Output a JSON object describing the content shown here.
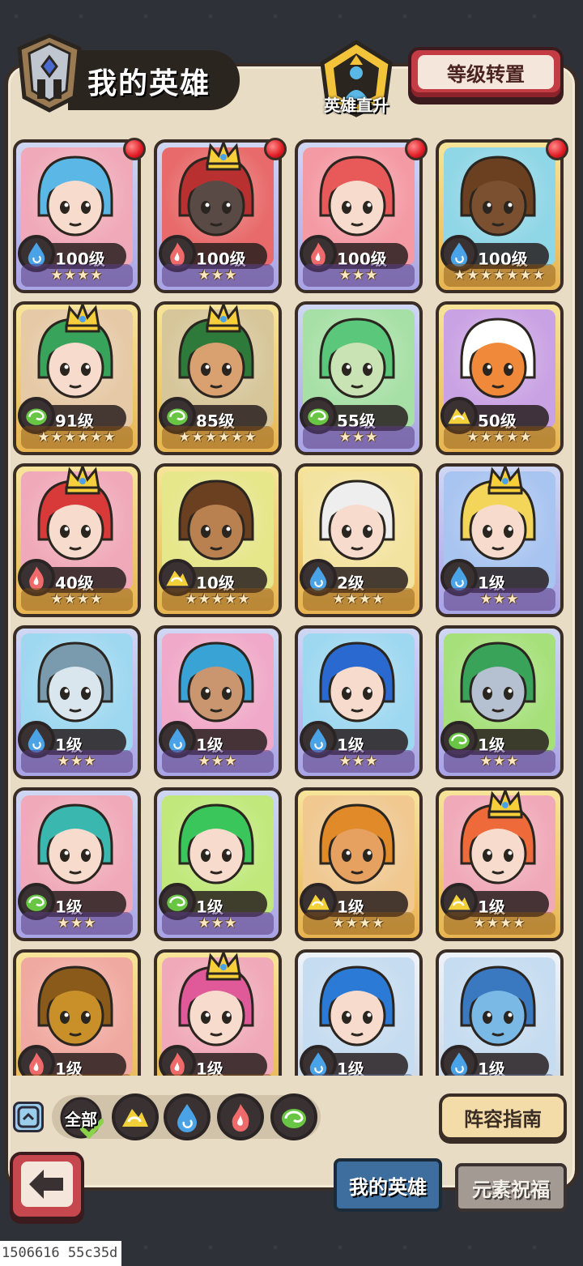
{
  "header": {
    "title": "我的英雄",
    "direct_up_label": "英雄直升",
    "level_transfer_label": "等级转置"
  },
  "elements": {
    "water": "#4aa3e6",
    "fire": "#ef6b6b",
    "wood": "#69c644",
    "earth": "#f2d03a"
  },
  "heroes": [
    {
      "level": "100级",
      "element": "water",
      "stars": "★★★★",
      "frame": "purple",
      "crown": false,
      "red_dot": true,
      "bg": "#f0a9b8",
      "skin": "#f7dccd",
      "hair": "#5bb8e6"
    },
    {
      "level": "100级",
      "element": "fire",
      "stars": "★★★",
      "frame": "purple",
      "crown": true,
      "red_dot": true,
      "bg": "#e86a6a",
      "skin": "#5a4a45",
      "hair": "#b83030"
    },
    {
      "level": "100级",
      "element": "fire",
      "stars": "★★★",
      "frame": "purple",
      "crown": false,
      "red_dot": true,
      "bg": "#f49aa4",
      "skin": "#f7dccd",
      "hair": "#e85a5a"
    },
    {
      "level": "100级",
      "element": "water",
      "stars": "★★★★★★★",
      "frame": "gold",
      "crown": false,
      "red_dot": true,
      "bg": "#8fd6e6",
      "skin": "#7a5030",
      "hair": "#6a4020"
    },
    {
      "level": "91级",
      "element": "wood",
      "stars": "★★★★★★",
      "frame": "gold",
      "crown": true,
      "red_dot": false,
      "bg": "#e6c9a6",
      "skin": "#f7dccd",
      "hair": "#38a35a"
    },
    {
      "level": "85级",
      "element": "wood",
      "stars": "★★★★★★",
      "frame": "gold",
      "crown": true,
      "red_dot": false,
      "bg": "#d7c69a",
      "skin": "#d9a070",
      "hair": "#2e7a3a"
    },
    {
      "level": "55级",
      "element": "wood",
      "stars": "★★★",
      "frame": "purple",
      "crown": false,
      "red_dot": false,
      "bg": "#a7e0a6",
      "skin": "#c9e3b4",
      "hair": "#5ac77a"
    },
    {
      "level": "50级",
      "element": "earth",
      "stars": "★★★★★",
      "frame": "gold",
      "crown": false,
      "red_dot": false,
      "bg": "#c9a2e3",
      "skin": "#f08a3a",
      "hair": "#ffffff"
    },
    {
      "level": "40级",
      "element": "fire",
      "stars": "★★★★",
      "frame": "gold",
      "crown": true,
      "red_dot": false,
      "bg": "#f0a9b8",
      "skin": "#f7dccd",
      "hair": "#d83a3a"
    },
    {
      "level": "10级",
      "element": "earth",
      "stars": "★★★★★",
      "frame": "gold",
      "crown": false,
      "red_dot": false,
      "bg": "#e6e68a",
      "skin": "#b98050",
      "hair": "#6a4020"
    },
    {
      "level": "2级",
      "element": "water",
      "stars": "★★★★",
      "frame": "gold",
      "crown": false,
      "red_dot": false,
      "bg": "#f3e3a0",
      "skin": "#f7dccd",
      "hair": "#eeeeee"
    },
    {
      "level": "1级",
      "element": "water",
      "stars": "★★★",
      "frame": "purple",
      "crown": true,
      "red_dot": false,
      "bg": "#a8c4f0",
      "skin": "#f7dccd",
      "hair": "#f3d55a"
    },
    {
      "level": "1级",
      "element": "water",
      "stars": "★★★",
      "frame": "purple",
      "crown": false,
      "red_dot": false,
      "bg": "#9ed8f0",
      "skin": "#d9e6ee",
      "hair": "#7a9aae"
    },
    {
      "level": "1级",
      "element": "water",
      "stars": "★★★",
      "frame": "purple",
      "crown": false,
      "red_dot": false,
      "bg": "#f0a9c8",
      "skin": "#c99670",
      "hair": "#3aa3d6"
    },
    {
      "level": "1级",
      "element": "water",
      "stars": "★★★",
      "frame": "purple",
      "crown": false,
      "red_dot": false,
      "bg": "#9ed8f0",
      "skin": "#f7dccd",
      "hair": "#2a6ad0"
    },
    {
      "level": "1级",
      "element": "wood",
      "stars": "★★★",
      "frame": "purple",
      "crown": false,
      "red_dot": false,
      "bg": "#a6e07a",
      "skin": "#b5c0d0",
      "hair": "#3aa35a"
    },
    {
      "level": "1级",
      "element": "wood",
      "stars": "★★★",
      "frame": "purple",
      "crown": false,
      "red_dot": false,
      "bg": "#f0a9b8",
      "skin": "#f7dccd",
      "hair": "#3ab8b0"
    },
    {
      "level": "1级",
      "element": "wood",
      "stars": "★★★",
      "frame": "purple",
      "crown": false,
      "red_dot": false,
      "bg": "#c0e87a",
      "skin": "#f7dccd",
      "hair": "#3ac65a"
    },
    {
      "level": "1级",
      "element": "earth",
      "stars": "★★★★",
      "frame": "gold",
      "crown": false,
      "red_dot": false,
      "bg": "#f0c890",
      "skin": "#e6a060",
      "hair": "#e08a2a"
    },
    {
      "level": "1级",
      "element": "earth",
      "stars": "★★★★",
      "frame": "gold",
      "crown": true,
      "red_dot": false,
      "bg": "#f0a9b8",
      "skin": "#f7dccd",
      "hair": "#ef6a3a"
    },
    {
      "level": "1级",
      "element": "fire",
      "stars": "★★★",
      "frame": "gold",
      "crown": false,
      "red_dot": false,
      "bg": "#f0a9a0",
      "skin": "#c9902a",
      "hair": "#8a5a1a"
    },
    {
      "level": "1级",
      "element": "fire",
      "stars": "★★★",
      "frame": "gold",
      "crown": true,
      "red_dot": false,
      "bg": "#f0a9b8",
      "skin": "#f7dccd",
      "hair": "#e05a9a"
    },
    {
      "level": "1级",
      "element": "water",
      "stars": "★★★",
      "frame": "light",
      "crown": false,
      "red_dot": false,
      "bg": "#c6dcf0",
      "skin": "#f7dccd",
      "hair": "#2a7ad6"
    },
    {
      "level": "1级",
      "element": "water",
      "stars": "★★★",
      "frame": "light",
      "crown": false,
      "red_dot": false,
      "bg": "#c6dcf0",
      "skin": "#7ab8e6",
      "hair": "#3a78c0"
    }
  ],
  "filter": {
    "all_label": "全部",
    "chips": [
      "earth",
      "water",
      "fire",
      "wood"
    ]
  },
  "formation_guide_label": "阵容指南",
  "tabs": {
    "my_heroes": "我的英雄",
    "element_blessing": "元素祝福"
  },
  "footer_id": "1506616 55c35d"
}
